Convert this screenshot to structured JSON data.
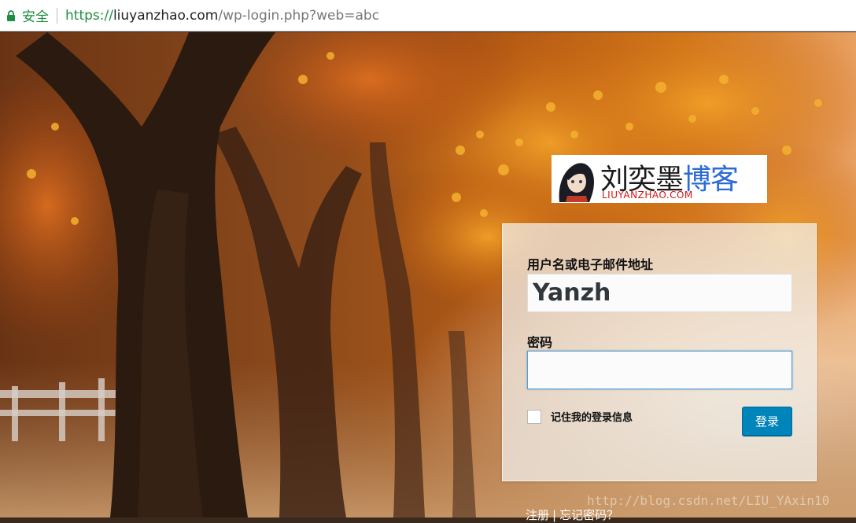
{
  "browser": {
    "secure_label": "安全",
    "url_scheme": "https://",
    "url_host": "liuyanzhao.com",
    "url_path": "/wp-login.php?web=abc"
  },
  "logo": {
    "name_black": "刘奕墨",
    "name_blue": "博客",
    "domain": "LIUYANZHAO.COM"
  },
  "login": {
    "username_label": "用户名或电子邮件地址",
    "username_value": "Yanzh",
    "password_label": "密码",
    "password_value": "",
    "remember_label": "记住我的登录信息",
    "remember_checked": false,
    "submit_label": "登录"
  },
  "nav": {
    "register": "注册",
    "separator": "|",
    "lost_password": "忘记密码？"
  },
  "watermark": "http://blog.csdn.net/LIU_YAxin10",
  "colors": {
    "secure_green": "#1e8e3e",
    "button_blue": "#0085ba",
    "logo_red": "#d41414",
    "logo_blue": "#2a6bd6"
  }
}
